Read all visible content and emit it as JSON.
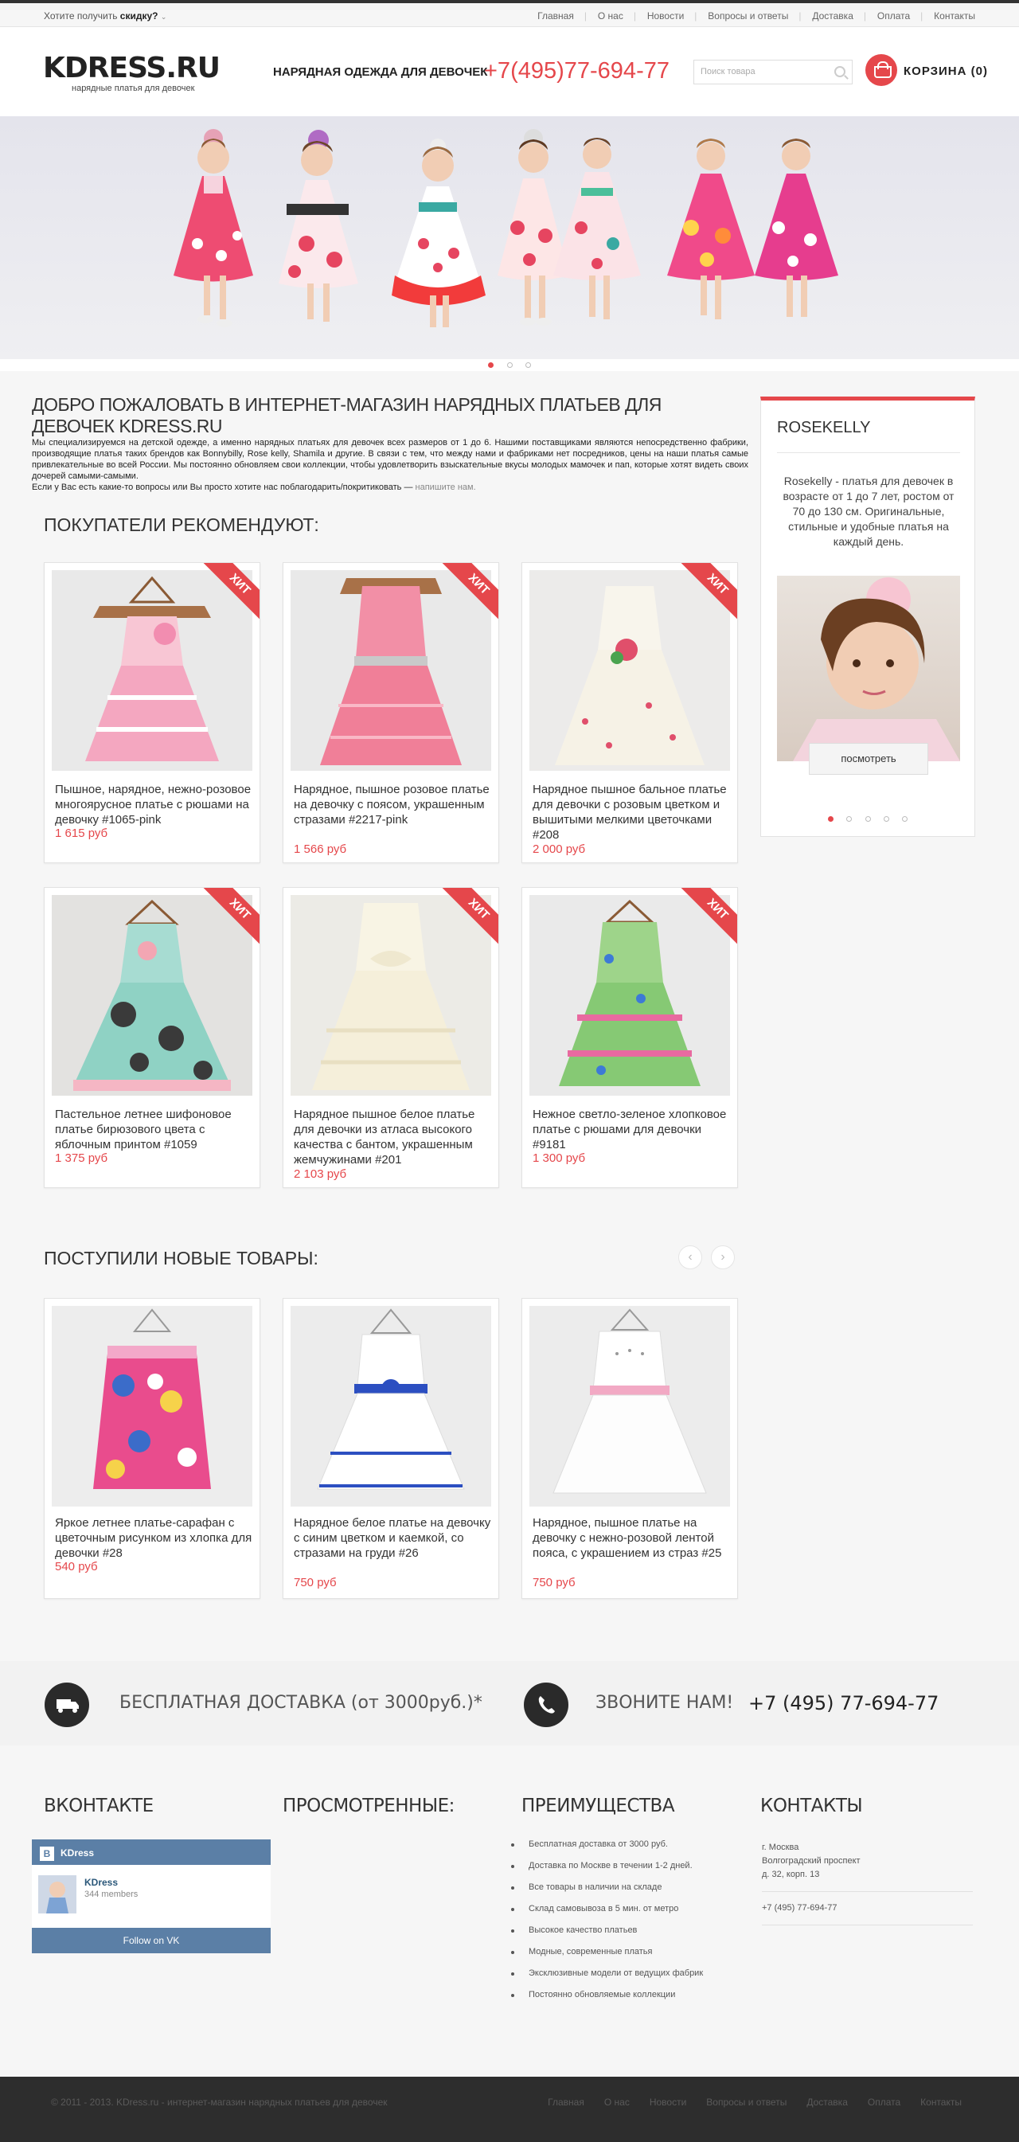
{
  "topbar": {
    "promo_text": "Хотите получить ",
    "promo_bold": "скидку?",
    "nav": [
      "Главная",
      "О нас",
      "Новости",
      "Вопросы и ответы",
      "Доставка",
      "Оплата",
      "Контакты"
    ]
  },
  "header": {
    "logo": "KDRESS.RU",
    "logo_tagline": "нарядные платья для девочек",
    "slogan": "НАРЯДНАЯ ОДЕЖДА ДЛЯ ДЕВОЧЕК",
    "phone": "+7(495)77-694-77",
    "search_placeholder": "Поиск товара",
    "cart_label": "КОРЗИНА (0)"
  },
  "welcome": {
    "title": "ДОБРО ПОЖАЛОВАТЬ В ИНТЕРНЕТ-МАГАЗИН НАРЯДНЫХ ПЛАТЬЕВ ДЛЯ ДЕВОЧЕК KDRESS.RU",
    "paragraph": "Мы специализируемся на детской одежде, а именно нарядных платьях для девочек всех размеров от 1 до 6. Нашими поставщиками являются непосредственно фабрики, производящие платья таких брендов как Bonnybilly, Rose kelly, Shamila и другие. В связи с тем, что между нами и фабриками нет посредников, цены на наши платья самые привлекательные во всей России. Мы постоянно обновляем свои коллекции, чтобы удовлетворить взыскательные вкусы молодых мамочек и пап, которые хотят видеть своих дочерей самыми-самыми.",
    "question": "Если у Вас есть какие-то вопросы или Вы просто хотите нас поблагодарить/покритиковать — ",
    "question_link": "напишите нам."
  },
  "recommended": {
    "title": "ПОКУПАТЕЛИ РЕКОМЕНДУЮТ:",
    "badge": "ХИТ",
    "products": [
      {
        "name": "Пышное, нарядное, нежно-розовое многоярусное платье с рюшами на девочку #1065-pink",
        "price": "1 615 руб"
      },
      {
        "name": "Нарядное, пышное розовое платье на девочку с поясом, украшенным стразами #2217-pink",
        "price": "1 566 руб"
      },
      {
        "name": "Нарядное пышное бальное платье для девочки с розовым цветком и вышитыми мелкими цветочками #208",
        "price": "2 000 руб"
      },
      {
        "name": "Пастельное летнее шифоновое платье бирюзового цвета с яблочным принтом #1059",
        "price": "1 375 руб"
      },
      {
        "name": "Нарядное пышное белое платье для девочки из атласа высокого качества с бантом, украшенным жемчужинами #201",
        "price": "2 103 руб"
      },
      {
        "name": "Нежное светло-зеленое хлопковое платье с рюшами для девочки #9181",
        "price": "1 300 руб"
      }
    ]
  },
  "new_arrivals": {
    "title": "ПОСТУПИЛИ НОВЫЕ ТОВАРЫ:",
    "prev": "‹",
    "next": "›",
    "products": [
      {
        "name": "Яркое летнее платье-сарафан с цветочным рисунком из хлопка для девочки #28",
        "price": "540 руб"
      },
      {
        "name": "Нарядное белое платье на девочку с синим цветком и каемкой, со стразами на груди #26",
        "price": "750 руб"
      },
      {
        "name": "Нарядное, пышное платье на девочку с нежно-розовой лентой пояса, с украшением из страз #25",
        "price": "750 руб"
      }
    ]
  },
  "sidebar": {
    "title": "ROSEKELLY",
    "text": "Rosekelly - платья для девочек в возрасте от 1 до 7 лет, ростом от 70 до 130 см. Оригинальные, стильные и удобные платья на каждый день.",
    "button": "посмотреть"
  },
  "features": {
    "delivery": "БЕСПЛАТНАЯ ДОСТАВКА (от 3000руб.)*",
    "call": "ЗВОНИТЕ НАМ!",
    "phone": "+7 (495) 77-694-77"
  },
  "footer": {
    "vk_title": "ВКОНТАКТЕ",
    "vk_logo": "B",
    "vk_group": "KDress",
    "vk_members": "344 members",
    "vk_follow": "Follow on VK",
    "viewed_title": "ПРОСМОТРЕННЫЕ:",
    "advantages_title": "ПРЕИМУЩЕСТВА",
    "advantages": [
      "Бесплатная доставка от 3000 руб.",
      "Доставка по Москве в течении 1-2 дней.",
      "Все товары в наличии на складе",
      "Склад самовывоза в 5 мин. от метро",
      "Высокое качество платьев",
      "Модные, современные платья",
      "Эксклюзивные модели от ведущих фабрик",
      "Постоянно обновляемые коллекции"
    ],
    "contacts_title": "КОНТАКТЫ",
    "address": [
      "г. Москва",
      "Волгоградский проспект",
      "д. 32, корп. 13"
    ],
    "phone": "+7 (495) 77-694-77"
  },
  "bottom": {
    "copyright": "© 2011 - 2013. KDress.ru - интернет-магазин нарядных платьев для девочек",
    "nav": [
      "Главная",
      "О нас",
      "Новости",
      "Вопросы и ответы",
      "Доставка",
      "Оплата",
      "Контакты"
    ]
  },
  "colors": {
    "accent": "#e5474b",
    "dark": "#2d2d2d",
    "vk": "#5b7fa6"
  }
}
